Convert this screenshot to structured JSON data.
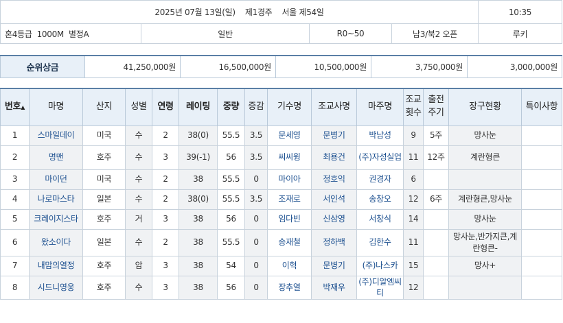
{
  "race_info": {
    "date_race": "2025년 07월 13일(일)    제1경주    서울 제54일",
    "time": "10:35",
    "class_distance": "혼4등급  1000M  별정A",
    "type": "일반",
    "rating_band": "R0~50",
    "weather_track": "남3/북2 오픈",
    "rookie": "루키"
  },
  "prize": {
    "label": "순위상금",
    "amounts": [
      "41,250,000원",
      "16,500,000원",
      "10,500,000원",
      "3,750,000원",
      "3,000,000원"
    ]
  },
  "columns": {
    "no": "번호",
    "sort_arrow": "▲",
    "horse": "마명",
    "origin": "산지",
    "sex": "성별",
    "age": "연령",
    "rating": "레이팅",
    "weight": "중량",
    "weight_change": "증감",
    "jockey": "기수명",
    "trainer": "조교사명",
    "owner": "마주명",
    "training_count": "조교\n횟수",
    "run_interval": "출전\n주기",
    "gear": "장구현황",
    "notes": "특이사항"
  },
  "rows": [
    {
      "no": "1",
      "horse": "스마일데이",
      "origin": "미국",
      "sex": "수",
      "age": "2",
      "rating": "38(0)",
      "weight": "55.5",
      "change": "3.5",
      "jockey": "문세영",
      "trainer": "문병기",
      "owner": "박남성",
      "training": "9",
      "interval": "5주",
      "gear": "망사눈",
      "notes": ""
    },
    {
      "no": "2",
      "horse": "명맨",
      "origin": "호주",
      "sex": "수",
      "age": "3",
      "rating": "39(-1)",
      "weight": "56",
      "change": "3.5",
      "jockey": "씨씨윙",
      "trainer": "최용건",
      "owner": "(주)자성실업",
      "training": "11",
      "interval": "12주",
      "gear": "계란형큰",
      "notes": ""
    },
    {
      "no": "3",
      "horse": "마이던",
      "origin": "미국",
      "sex": "수",
      "age": "2",
      "rating": "38",
      "weight": "55.5",
      "change": "0",
      "jockey": "마이아",
      "trainer": "정호익",
      "owner": "권경자",
      "training": "6",
      "interval": "",
      "gear": "",
      "notes": ""
    },
    {
      "no": "4",
      "horse": "나로마스타",
      "origin": "일본",
      "sex": "수",
      "age": "2",
      "rating": "38(0)",
      "weight": "55.5",
      "change": "3.5",
      "jockey": "조재로",
      "trainer": "서인석",
      "owner": "송창오",
      "training": "12",
      "interval": "6주",
      "gear": "계란형큰,망사눈",
      "notes": ""
    },
    {
      "no": "5",
      "horse": "크레이지스타",
      "origin": "호주",
      "sex": "거",
      "age": "3",
      "rating": "38",
      "weight": "56",
      "change": "0",
      "jockey": "임다빈",
      "trainer": "신삼영",
      "owner": "서창식",
      "training": "14",
      "interval": "",
      "gear": "망사눈",
      "notes": ""
    },
    {
      "no": "6",
      "horse": "왔소이다",
      "origin": "일본",
      "sex": "수",
      "age": "2",
      "rating": "38",
      "weight": "55.5",
      "change": "0",
      "jockey": "송재철",
      "trainer": "정하백",
      "owner": "김한수",
      "training": "11",
      "interval": "",
      "gear": "망사눈,반가지큰,계란형큰-",
      "notes": ""
    },
    {
      "no": "7",
      "horse": "내맘의열정",
      "origin": "호주",
      "sex": "암",
      "age": "3",
      "rating": "38",
      "weight": "54",
      "change": "0",
      "jockey": "이혁",
      "trainer": "문병기",
      "owner": "(주)나스카",
      "training": "15",
      "interval": "",
      "gear": "망사+",
      "notes": ""
    },
    {
      "no": "8",
      "horse": "시드니영웅",
      "origin": "호주",
      "sex": "수",
      "age": "3",
      "rating": "38",
      "weight": "56",
      "change": "0",
      "jockey": "장추열",
      "trainer": "박재우",
      "owner": "(주)디알엠씨티",
      "training": "12",
      "interval": "",
      "gear": "",
      "notes": ""
    }
  ]
}
